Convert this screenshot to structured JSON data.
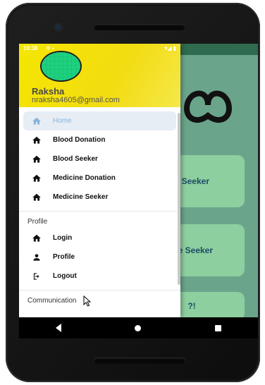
{
  "status_bar": {
    "time": "10:38"
  },
  "user": {
    "name": "Raksha",
    "email": "nraksha4605@gmail.com"
  },
  "menu": {
    "items": [
      {
        "label": "Home",
        "icon": "home-icon",
        "active": true
      },
      {
        "label": "Blood Donation",
        "icon": "home-icon"
      },
      {
        "label": "Blood Seeker",
        "icon": "home-icon"
      },
      {
        "label": "Medicine Donation",
        "icon": "home-icon"
      },
      {
        "label": "Medicine Seeker",
        "icon": "home-icon"
      }
    ],
    "profile_section": {
      "title": "Profile",
      "items": [
        {
          "label": "Login",
          "icon": "home-icon"
        },
        {
          "label": "Profile",
          "icon": "person-icon"
        },
        {
          "label": "Logout",
          "icon": "logout-icon"
        }
      ]
    },
    "communication_section": {
      "title": "Communication"
    }
  },
  "background_app": {
    "card1_label": "d Seeker",
    "card2_label": "ine Seeker",
    "card3_label": "?!"
  },
  "colors": {
    "header_yellow": "#f5e600",
    "app_green": "#6aa58b",
    "card_green": "#8dcf9f",
    "active_item_bg": "#e6edf4"
  }
}
